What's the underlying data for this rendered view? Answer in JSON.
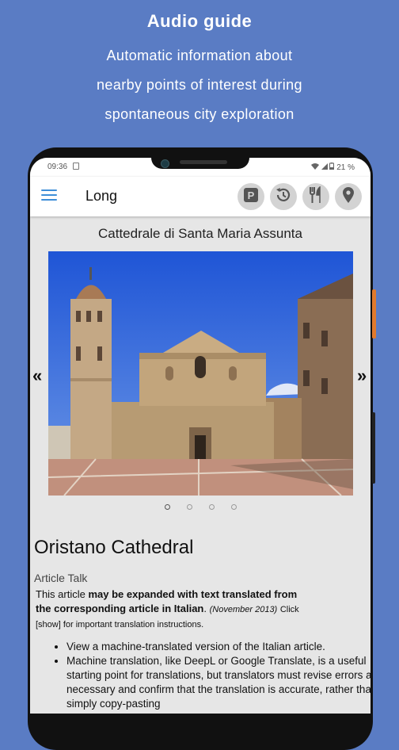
{
  "promo": {
    "title": "Audio guide",
    "line1": "Automatic information about",
    "line2": "nearby points of interest during",
    "line3": "spontaneous city exploration"
  },
  "status": {
    "time": "09:36",
    "battery": "21 %"
  },
  "appbar": {
    "title": "Long",
    "icons": [
      "menu-icon",
      "parking-icon",
      "history-icon",
      "restaurant-icon",
      "location-pin-icon"
    ],
    "accent": "#3f8fd8"
  },
  "place": {
    "name": "Cattedrale di Santa Maria Assunta"
  },
  "carousel": {
    "prev": "«",
    "next": "»",
    "count": 4,
    "active_index": 0
  },
  "article": {
    "heading": "Oristano Cathedral",
    "tabs": "Article Talk",
    "notice_prefix": "This article ",
    "notice_bold1": "may be expanded with text translated from",
    "notice_bold2": "the corresponding article in Italian",
    "notice_period": ".",
    "notice_date": "(November 2013)",
    "notice_click": "Click",
    "notice_line3": "[show] for important translation instructions.",
    "bullets": [
      "View a machine-translated version of the Italian article.",
      "Machine translation, like DeepL or Google Translate, is a useful starting point for translations, but translators must revise errors as necessary and confirm that the translation is accurate, rather than simply copy-pasting"
    ]
  },
  "colors": {
    "background": "#5a7cc4",
    "screen": "#e6e6e6",
    "side_button": "#e07a2c"
  }
}
